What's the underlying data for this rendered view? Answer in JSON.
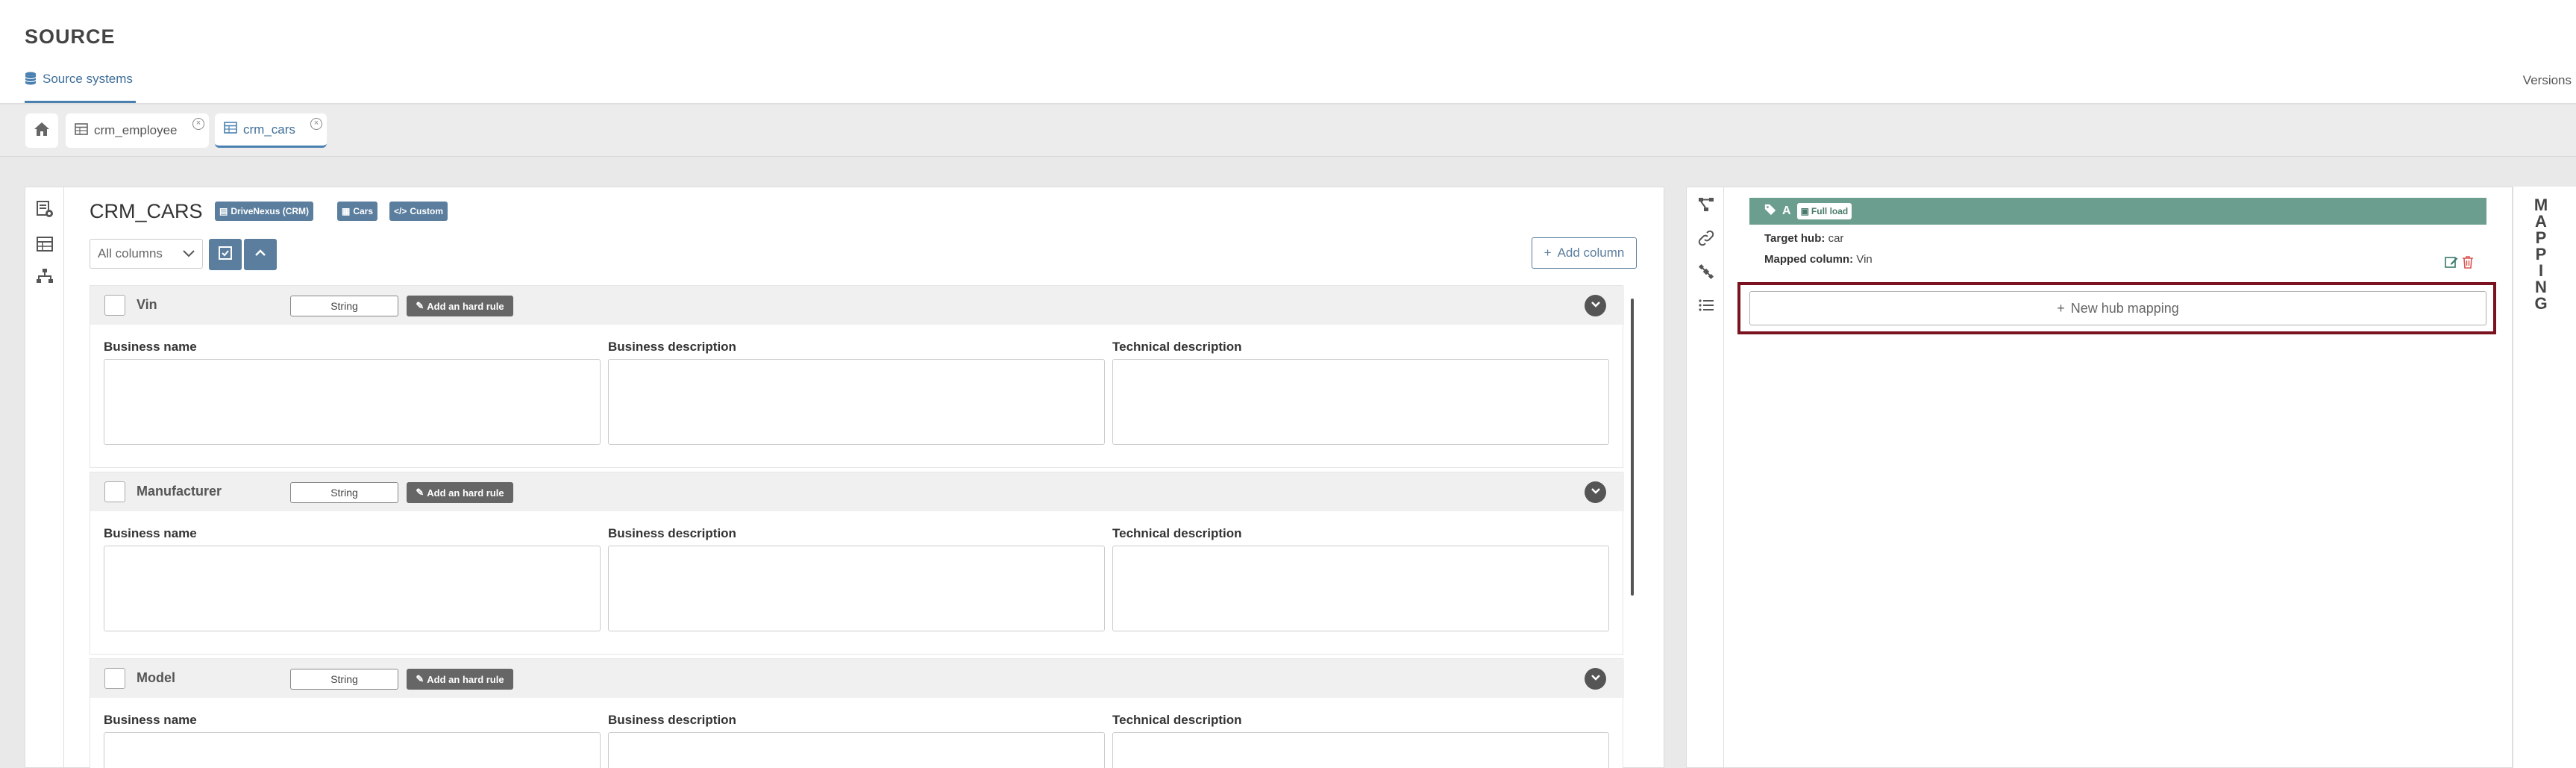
{
  "header": {
    "title": "SOURCE",
    "nav_tab": "Source systems",
    "versions": "Versions"
  },
  "tabs": [
    {
      "label": "crm_employee",
      "active": false
    },
    {
      "label": "crm_cars",
      "active": true
    }
  ],
  "main": {
    "title": "CRM_CARS",
    "badges": [
      "DriveNexus (CRM)",
      "Cars",
      "Custom"
    ],
    "column_filter": "All columns",
    "add_column_label": "Add column",
    "columns": [
      {
        "name": "Vin",
        "type": "String"
      },
      {
        "name": "Manufacturer",
        "type": "String"
      },
      {
        "name": "Model",
        "type": "String"
      }
    ],
    "hard_rule_label": "Add an hard rule",
    "field_labels": {
      "business_name": "Business name",
      "business_description": "Business description",
      "technical_description": "Technical description"
    }
  },
  "mapping": {
    "letter": "A",
    "load_badge": "Full load",
    "target_hub_label": "Target hub:",
    "target_hub_value": "car",
    "mapped_column_label": "Mapped column:",
    "mapped_column_value": "Vin",
    "new_hub_label": "New hub mapping",
    "vertical_title": [
      "M",
      "A",
      "P",
      "P",
      "I",
      "N",
      "G"
    ]
  },
  "colors": {
    "accent": "#5b7e9e",
    "mapping_header": "#6b9e8e",
    "highlight": "#7a1220"
  }
}
